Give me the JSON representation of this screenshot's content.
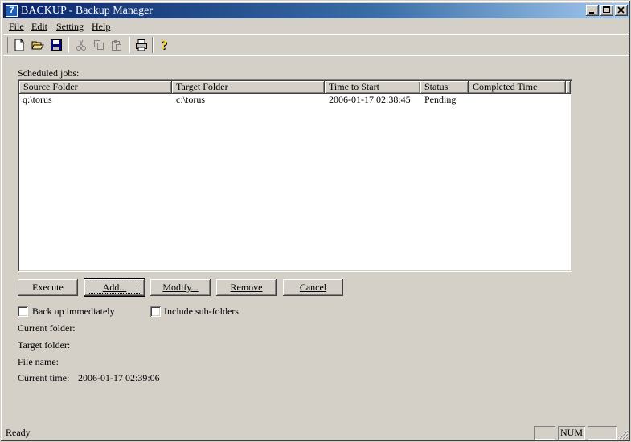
{
  "window": {
    "icon_glyph": "7",
    "title": "BACKUP - Backup Manager",
    "controls": [
      "minimize-icon",
      "maximize-icon",
      "close-icon"
    ]
  },
  "menu": [
    {
      "id": "file",
      "label": "File"
    },
    {
      "id": "edit",
      "label": "Edit"
    },
    {
      "id": "setting",
      "label": "Setting"
    },
    {
      "id": "help",
      "label": "Help"
    }
  ],
  "toolbar": {
    "tools": [
      "new-file-icon",
      "open-folder-icon",
      "save-icon",
      "cut-icon",
      "copy-icon",
      "paste-icon",
      "print-icon",
      "help-icon"
    ],
    "disabled": [
      "cut-icon",
      "copy-icon",
      "paste-icon"
    ]
  },
  "jobs": {
    "label": "Scheduled jobs:",
    "columns": [
      "Source Folder",
      "Target Folder",
      "Time to Start",
      "Status",
      "Completed Time"
    ],
    "rows": [
      [
        "q:\\torus",
        "c:\\torus",
        "2006-01-17 02:38:45",
        "Pending",
        ""
      ]
    ]
  },
  "buttons": {
    "execute": "Execute",
    "add": "Add...",
    "modify": "Modify...",
    "remove": "Remove",
    "cancel": "Cancel"
  },
  "options": {
    "backup_immediately": {
      "label": "Back up immediately",
      "checked": false
    },
    "include_subfolders": {
      "label": "Include sub-folders",
      "checked": false
    }
  },
  "info": {
    "current_folder_label": "Current folder:",
    "current_folder_value": "",
    "target_folder_label": "Target folder:",
    "target_folder_value": "",
    "file_name_label": "File name:",
    "file_name_value": "",
    "current_time_label": "Current time:",
    "current_time_value": "2006-01-17 02:39:06"
  },
  "status": {
    "text": "Ready",
    "panels": [
      "",
      "NUM",
      ""
    ]
  },
  "colors": {
    "face": "#d4d0c8",
    "title_start": "#0a246a",
    "title_end": "#a6caf0"
  }
}
